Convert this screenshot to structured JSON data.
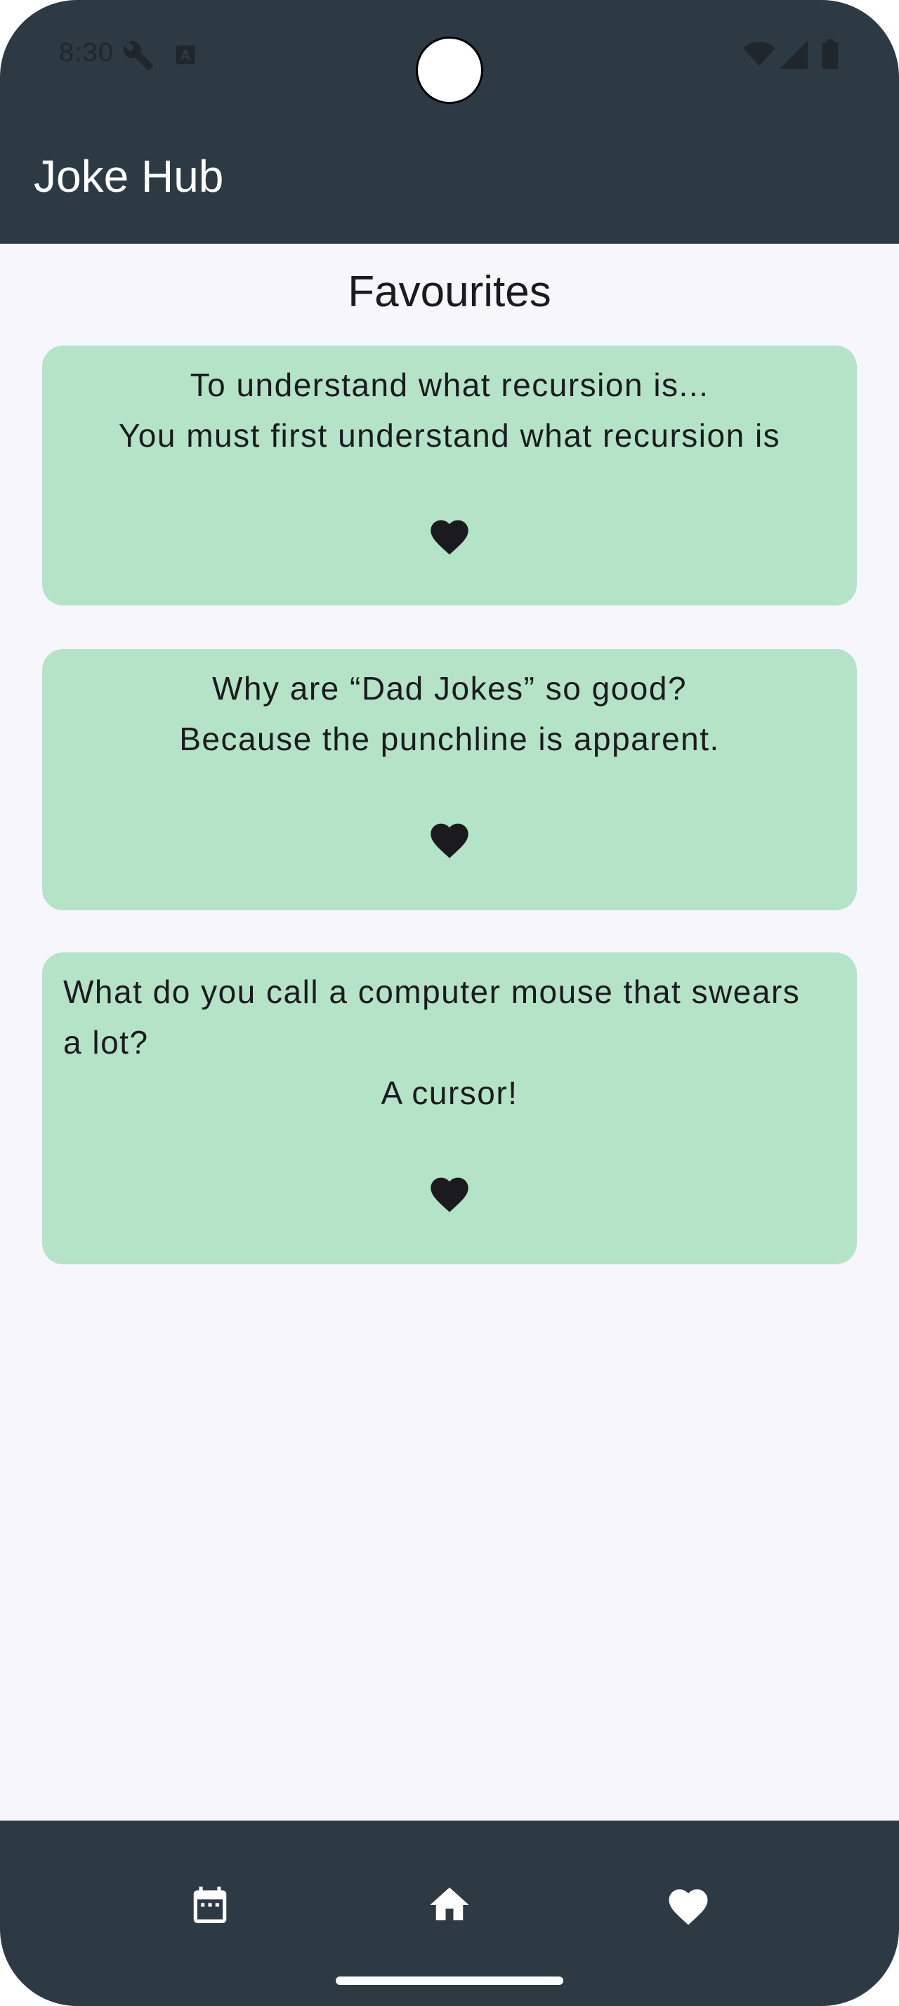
{
  "status_bar": {
    "time": "8:30"
  },
  "app_bar": {
    "title": "Joke Hub"
  },
  "page": {
    "heading": "Favourites"
  },
  "favourites": [
    {
      "setup_lines": [
        "To understand what recursion is..."
      ],
      "punchline": "You must first understand what recursion is",
      "favourited": true,
      "icon": "heart-filled"
    },
    {
      "setup_lines": [
        "Why are “Dad Jokes” so good?"
      ],
      "punchline": "Because the punchline is apparent.",
      "favourited": true,
      "icon": "heart-filled"
    },
    {
      "setup_lines": [
        "What do you call a computer mouse that swears",
        "a lot?"
      ],
      "punchline": "A cursor!",
      "favourited": true,
      "icon": "heart-filled"
    }
  ],
  "bottom_nav": {
    "items": [
      {
        "icon": "calendar-icon"
      },
      {
        "icon": "home-icon"
      },
      {
        "icon": "heart-icon"
      }
    ]
  },
  "colors": {
    "app_bar": "#2e3a43",
    "background": "#f6f6fc",
    "card": "#b5e3c7",
    "text": "#1b1b1f"
  }
}
